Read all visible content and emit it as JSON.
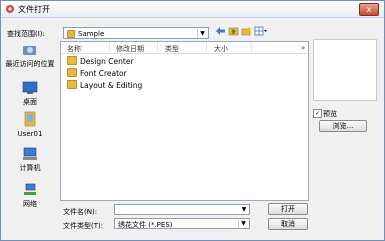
{
  "window": {
    "title": "文件打开",
    "close_label": "x"
  },
  "toolbar": {
    "lookin_label": "查找范围(I):",
    "lookin_value": "Sample",
    "more_label": "▾"
  },
  "places": [
    {
      "label": "最近访问的位置",
      "icon": "recent-places-icon"
    },
    {
      "label": "桌面",
      "icon": "desktop-icon"
    },
    {
      "label": "User01",
      "icon": "user-folder-icon"
    },
    {
      "label": "计算机",
      "icon": "computer-icon"
    },
    {
      "label": "网络",
      "icon": "network-icon"
    }
  ],
  "list": {
    "columns": [
      "名称",
      "修改日期",
      "类型",
      "大小"
    ],
    "more": "»",
    "items": [
      "Design Center",
      "Font Creator",
      "Layout & Editing"
    ]
  },
  "preview": {
    "checkbox_label": "预览",
    "checked": "✓",
    "browse_label": "浏览..."
  },
  "bottom": {
    "filename_label": "文件名(N):",
    "filename_value": "",
    "filetype_label": "文件类型(T):",
    "filetype_value": "绣花文件 (*.PES)",
    "open_label": "打开",
    "cancel_label": "取消"
  },
  "colors": {
    "folder": "#e7b845",
    "accent": "#2f5ea8"
  }
}
